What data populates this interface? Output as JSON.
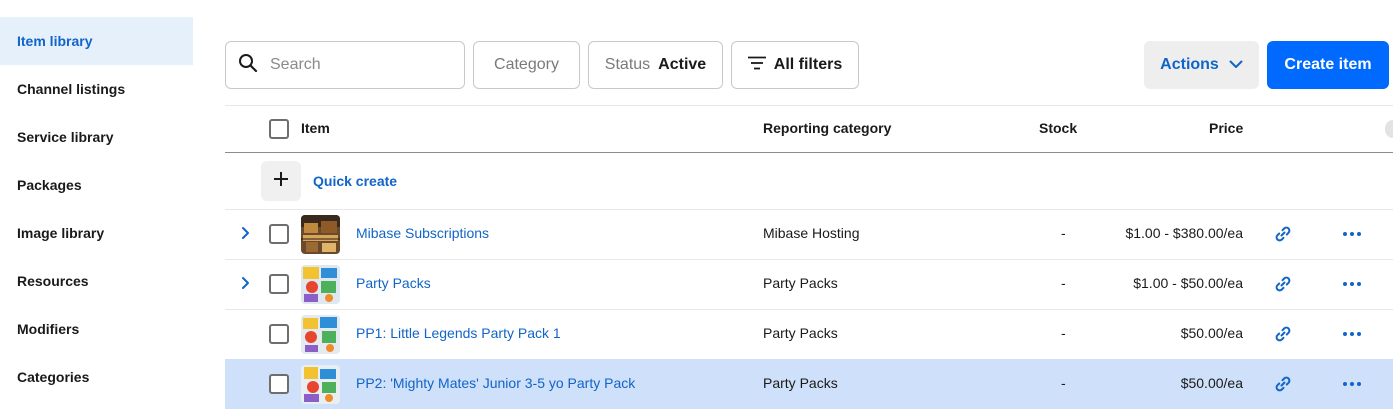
{
  "sidebar": {
    "items": [
      {
        "label": "Item library",
        "active": true
      },
      {
        "label": "Channel listings",
        "active": false
      },
      {
        "label": "Service library",
        "active": false
      },
      {
        "label": "Packages",
        "active": false
      },
      {
        "label": "Image library",
        "active": false
      },
      {
        "label": "Resources",
        "active": false
      },
      {
        "label": "Modifiers",
        "active": false
      },
      {
        "label": "Categories",
        "active": false
      }
    ]
  },
  "toolbar": {
    "search_placeholder": "Search",
    "category_label": "Category",
    "status_label": "Status",
    "status_value": "Active",
    "all_filters_label": "All filters",
    "actions_label": "Actions",
    "create_label": "Create item"
  },
  "table": {
    "columns": {
      "item": "Item",
      "category": "Reporting category",
      "stock": "Stock",
      "price": "Price"
    },
    "quick_create_label": "Quick create",
    "rows": [
      {
        "name": "Mibase Subscriptions",
        "category": "Mibase Hosting",
        "stock": "-",
        "price": "$1.00 - $380.00/ea",
        "expandable": true,
        "selected": false
      },
      {
        "name": "Party Packs",
        "category": "Party Packs",
        "stock": "-",
        "price": "$1.00 - $50.00/ea",
        "expandable": true,
        "selected": false
      },
      {
        "name": "PP1: Little Legends Party Pack 1",
        "category": "Party Packs",
        "stock": "-",
        "price": "$50.00/ea",
        "expandable": false,
        "selected": false
      },
      {
        "name": "PP2: 'Mighty Mates' Junior 3-5 yo Party Pack",
        "category": "Party Packs",
        "stock": "-",
        "price": "$50.00/ea",
        "expandable": false,
        "selected": true
      }
    ]
  },
  "colors": {
    "accent": "#006aff",
    "link": "#1164c8",
    "selected_row": "#cfe0fa",
    "active_nav": "#e6f0fb"
  }
}
